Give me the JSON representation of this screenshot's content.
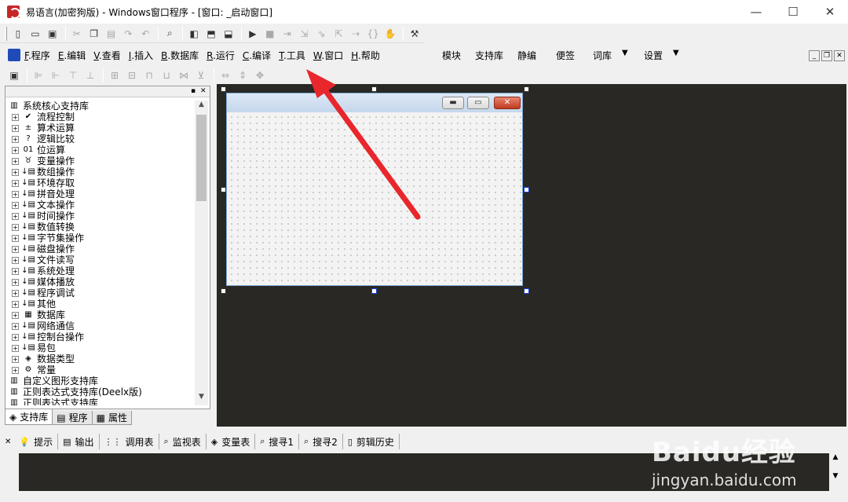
{
  "window": {
    "title": "易语言(加密狗版) - Windows窗口程序 - [窗口: _启动窗口]",
    "controls": [
      "—",
      "☐",
      "✕"
    ]
  },
  "menu": {
    "items": [
      {
        "key": "F",
        "label": ".程序"
      },
      {
        "key": "E",
        "label": ".编辑"
      },
      {
        "key": "V",
        "label": ".查看"
      },
      {
        "key": "I",
        "label": ".插入"
      },
      {
        "key": "B",
        "label": ".数据库"
      },
      {
        "key": "R",
        "label": ".运行"
      },
      {
        "key": "C",
        "label": ".编译"
      },
      {
        "key": "T",
        "label": ".工具"
      },
      {
        "key": "W",
        "label": ".窗口"
      },
      {
        "key": "H",
        "label": ".帮助"
      }
    ],
    "right_items": [
      "模块",
      "支持库",
      "静编",
      "便签",
      "词库",
      "设置"
    ]
  },
  "library_panel": {
    "root": "系统核心支持库",
    "children": [
      {
        "icon": "check-icon",
        "label": "流程控制"
      },
      {
        "icon": "math-icon",
        "label": "算术运算"
      },
      {
        "icon": "question-icon",
        "label": "逻辑比较"
      },
      {
        "icon": "bit-icon",
        "label": "位运算"
      },
      {
        "icon": "variable-icon",
        "label": "变量操作"
      },
      {
        "icon": "command-icon",
        "label": "数组操作"
      },
      {
        "icon": "command-icon",
        "label": "环境存取"
      },
      {
        "icon": "command-icon",
        "label": "拼音处理"
      },
      {
        "icon": "command-icon",
        "label": "文本操作"
      },
      {
        "icon": "command-icon",
        "label": "时间操作"
      },
      {
        "icon": "command-icon",
        "label": "数值转换"
      },
      {
        "icon": "command-icon",
        "label": "字节集操作"
      },
      {
        "icon": "command-icon",
        "label": "磁盘操作"
      },
      {
        "icon": "command-icon",
        "label": "文件读写"
      },
      {
        "icon": "command-icon",
        "label": "系统处理"
      },
      {
        "icon": "command-icon",
        "label": "媒体播放"
      },
      {
        "icon": "command-icon",
        "label": "程序调试"
      },
      {
        "icon": "command-icon",
        "label": "其他"
      },
      {
        "icon": "database-icon",
        "label": "数据库"
      },
      {
        "icon": "command-icon",
        "label": "网络通信"
      },
      {
        "icon": "command-icon",
        "label": "控制台操作"
      },
      {
        "icon": "command-icon",
        "label": "易包"
      },
      {
        "icon": "datatype-icon",
        "label": "数据类型"
      },
      {
        "icon": "constant-icon",
        "label": "常量"
      }
    ],
    "other_roots": [
      "自定义图形支持库",
      "正则表达式支持库(Deelx版)",
      "正则表达式支持库"
    ],
    "tabs": [
      "支持库",
      "程序",
      "属性"
    ]
  },
  "bottom_panel": {
    "tabs": [
      "提示",
      "输出",
      "调用表",
      "监视表",
      "变量表",
      "搜寻1",
      "搜寻2",
      "剪辑历史"
    ]
  },
  "watermark": {
    "main": "Baidu经验",
    "sub": "jingyan.baidu.com"
  }
}
